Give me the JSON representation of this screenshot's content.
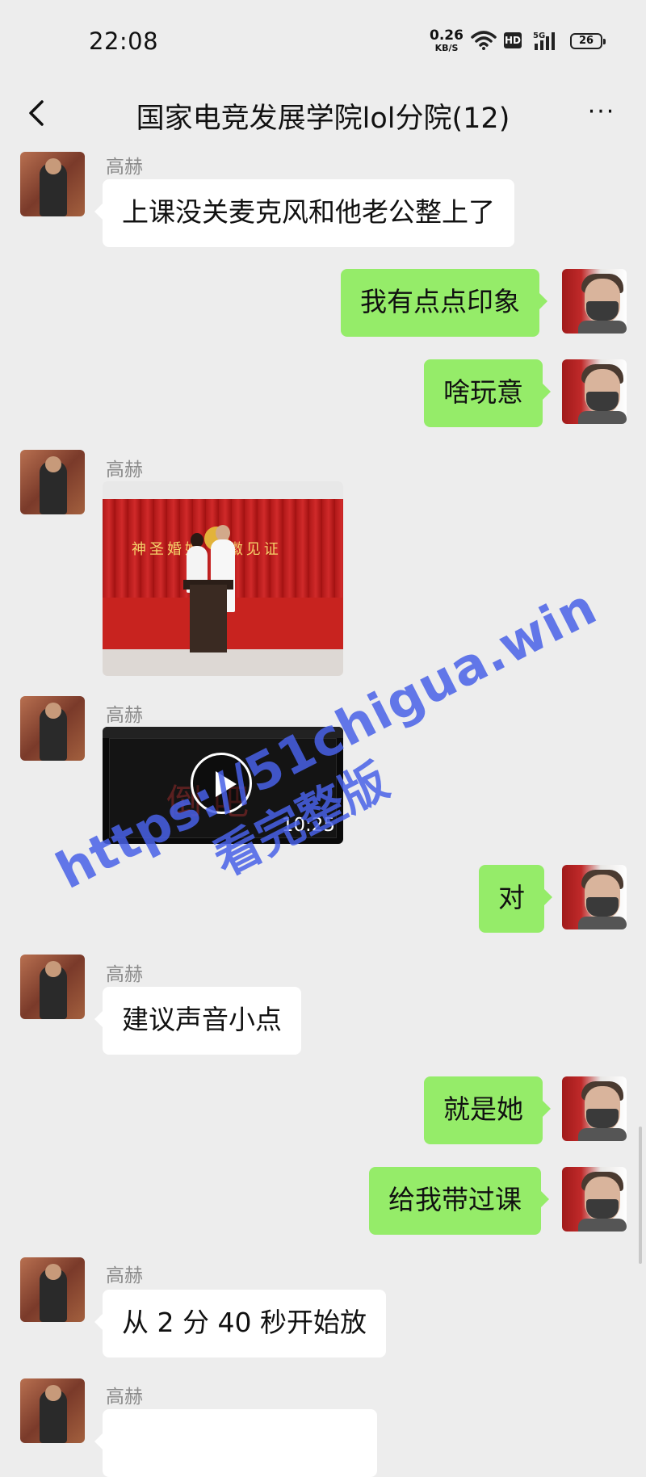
{
  "status": {
    "time": "22:08",
    "net_speed_value": "0.26",
    "net_speed_unit": "KB/S",
    "hd": "HD",
    "network": "5G",
    "battery": "26"
  },
  "header": {
    "title": "国家电竞发展学院lol分院(12)",
    "more": "···"
  },
  "messages": [
    {
      "side": "left",
      "sender": "高赫",
      "type": "text",
      "text": "上课没关麦克风和他老公整上了"
    },
    {
      "side": "right",
      "type": "text",
      "text": "我有点点印象"
    },
    {
      "side": "right",
      "type": "text",
      "text": "啥玩意"
    },
    {
      "side": "left",
      "sender": "高赫",
      "type": "image",
      "image_text": "神圣婚姻  国徽见证"
    },
    {
      "side": "left",
      "sender": "高赫",
      "type": "video",
      "duration": "10:25"
    },
    {
      "side": "right",
      "type": "text",
      "text": "对"
    },
    {
      "side": "left",
      "sender": "高赫",
      "type": "text",
      "text": "建议声音小点"
    },
    {
      "side": "right",
      "type": "text",
      "text": "就是她"
    },
    {
      "side": "right",
      "type": "text",
      "text": "给我带过课"
    },
    {
      "side": "left",
      "sender": "高赫",
      "type": "text",
      "text": "从 2 分 40 秒开始放"
    },
    {
      "side": "left",
      "sender": "高赫",
      "type": "text",
      "text": ""
    }
  ],
  "watermark": {
    "url": "https://51chigua.win",
    "subtitle": "看完整版"
  },
  "colors": {
    "background": "#ededed",
    "bubble_self": "#95ec69",
    "bubble_other": "#ffffff",
    "watermark": "#4860e6"
  }
}
